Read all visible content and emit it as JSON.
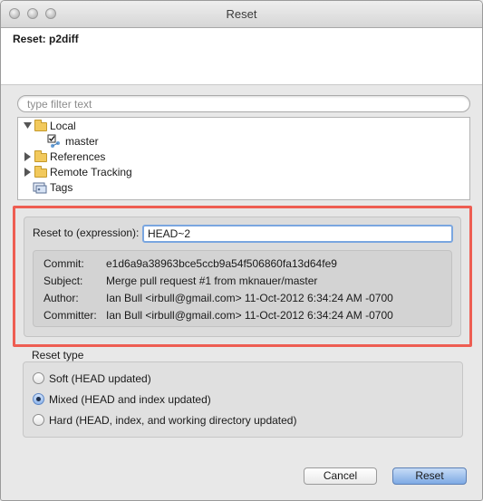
{
  "window": {
    "title": "Reset"
  },
  "header": {
    "title": "Reset: p2diff"
  },
  "filter": {
    "placeholder": "type filter text"
  },
  "tree": {
    "items": [
      {
        "label": "Local"
      },
      {
        "label": "master"
      },
      {
        "label": "References"
      },
      {
        "label": "Remote Tracking"
      },
      {
        "label": "Tags"
      }
    ]
  },
  "expression": {
    "label": "Reset to (expression):",
    "value": "HEAD~2"
  },
  "details": {
    "commit_label": "Commit:",
    "commit": "e1d6a9a38963bce5ccb9a54f506860fa13d64fe9",
    "subject_label": "Subject:",
    "subject": "Merge pull request #1 from mknauer/master",
    "author_label": "Author:",
    "author": "Ian Bull <irbull@gmail.com> 11-Oct-2012 6:34:24 AM -0700",
    "committer_label": "Committer:",
    "committer": "Ian Bull <irbull@gmail.com> 11-Oct-2012 6:34:24 AM -0700"
  },
  "reset_type": {
    "label": "Reset type",
    "options": [
      {
        "label": "Soft (HEAD updated)",
        "selected": false
      },
      {
        "label": "Mixed (HEAD and index updated)",
        "selected": true
      },
      {
        "label": "Hard (HEAD, index, and working directory updated)",
        "selected": false
      }
    ]
  },
  "buttons": {
    "cancel": "Cancel",
    "reset": "Reset"
  },
  "colors": {
    "highlight_border": "#ee5d52",
    "default_button": "#7ea9e4",
    "focus_ring": "#7aa6e0"
  }
}
